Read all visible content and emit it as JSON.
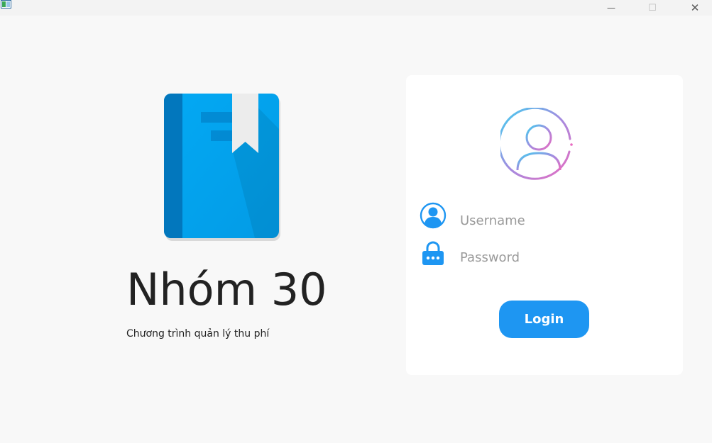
{
  "window": {
    "minimize_glyph": "—",
    "maximize_glyph": "☐",
    "close_glyph": "✕"
  },
  "brand": {
    "title": "Nhóm 30",
    "subtitle": "Chương trình quản lý thu phí",
    "icon": "book-icon"
  },
  "login": {
    "avatar_icon": "user-avatar-icon",
    "username": {
      "icon": "user-icon",
      "value": "",
      "placeholder": "Username"
    },
    "password": {
      "icon": "lock-icon",
      "value": "",
      "placeholder": "Password"
    },
    "button_label": "Login"
  },
  "colors": {
    "accent": "#1e96f2",
    "book_blue": "#03a9f4",
    "book_spine": "#0277bd",
    "background": "#f8f8f8",
    "card": "#ffffff"
  }
}
